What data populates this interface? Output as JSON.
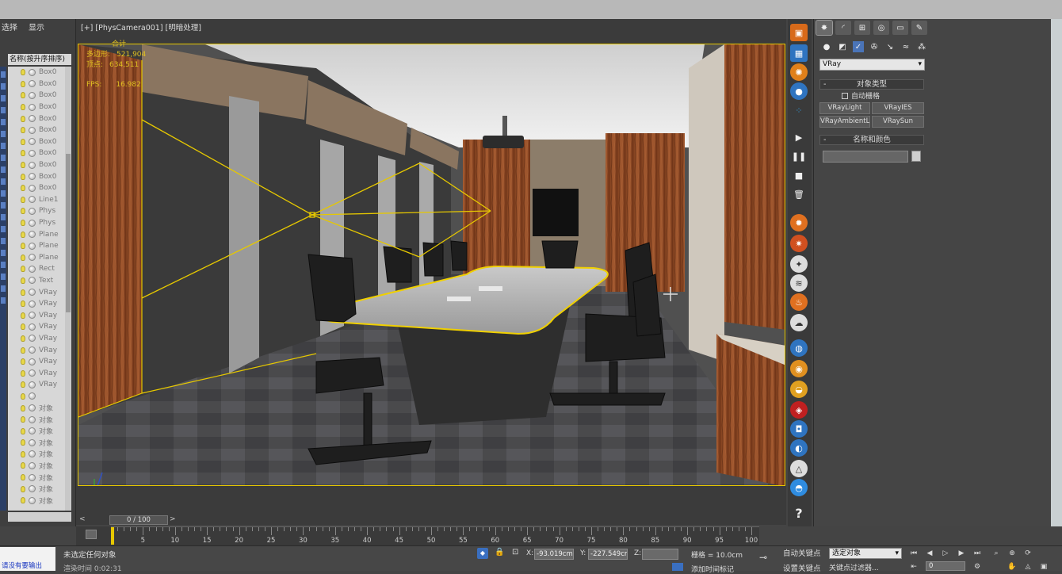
{
  "left_panel": {
    "menu": [
      "选择",
      "显示"
    ],
    "header": "名称(按升序排序)",
    "items": [
      {
        "label": "Box0",
        "icon": "lightbulb-icon"
      },
      {
        "label": "Box0",
        "icon": "lightbulb-icon"
      },
      {
        "label": "Box0",
        "icon": "lightbulb-icon"
      },
      {
        "label": "Box0",
        "icon": "lightbulb-icon"
      },
      {
        "label": "Box0",
        "icon": "lightbulb-icon"
      },
      {
        "label": "Box0",
        "icon": "lightbulb-icon"
      },
      {
        "label": "Box0",
        "icon": "lightbulb-icon"
      },
      {
        "label": "Box0",
        "icon": "lightbulb-icon"
      },
      {
        "label": "Box0",
        "icon": "lightbulb-icon"
      },
      {
        "label": "Box0",
        "icon": "lightbulb-icon"
      },
      {
        "label": "Box0",
        "icon": "lightbulb-icon"
      },
      {
        "label": "Line1",
        "icon": "lightbulb-icon"
      },
      {
        "label": "Phys",
        "icon": "camera-icon"
      },
      {
        "label": "Phys",
        "icon": "camera-icon"
      },
      {
        "label": "Plane",
        "icon": "lightbulb-icon"
      },
      {
        "label": "Plane",
        "icon": "lightbulb-icon"
      },
      {
        "label": "Plane",
        "icon": "lightbulb-icon"
      },
      {
        "label": "Rect",
        "icon": "lightbulb-icon"
      },
      {
        "label": "Text",
        "icon": "lightbulb-icon"
      },
      {
        "label": "VRay",
        "icon": "lightbulb-icon"
      },
      {
        "label": "VRay",
        "icon": "lightbulb-icon"
      },
      {
        "label": "VRay",
        "icon": "lightbulb-icon"
      },
      {
        "label": "VRay",
        "icon": "lightbulb-icon"
      },
      {
        "label": "VRay",
        "icon": "lightbulb-icon"
      },
      {
        "label": "VRay",
        "icon": "lightbulb-icon"
      },
      {
        "label": "VRay",
        "icon": "lightbulb-icon"
      },
      {
        "label": "VRay",
        "icon": "lightbulb-icon"
      },
      {
        "label": "VRay",
        "icon": "lightbulb-icon"
      },
      {
        "label": "",
        "icon": "lightbulb-icon"
      },
      {
        "label": "对象",
        "icon": "lightbulb-icon"
      },
      {
        "label": "对象",
        "icon": "lightbulb-icon"
      },
      {
        "label": "对象",
        "icon": "lightbulb-icon"
      },
      {
        "label": "对象",
        "icon": "lightbulb-icon"
      },
      {
        "label": "对象",
        "icon": "lightbulb-icon"
      },
      {
        "label": "对象",
        "icon": "lightbulb-icon"
      },
      {
        "label": "对象",
        "icon": "lightbulb-icon"
      },
      {
        "label": "对象",
        "icon": "lightbulb-icon"
      },
      {
        "label": "对象",
        "icon": "lightbulb-icon"
      }
    ]
  },
  "viewport": {
    "label": "[+] [PhysCamera001] [明暗处理]",
    "stats": {
      "title": "合计",
      "polys_label": "多边形:",
      "polys_value": "521,904",
      "verts_label": "顶点:",
      "verts_value": "634,511",
      "fps_label": "FPS:",
      "fps_value": "16.982"
    }
  },
  "command_panel": {
    "renderer_dropdown": "VRay",
    "object_type": {
      "title": "对象类型",
      "autogrid": "自动栅格",
      "buttons": [
        "VRayLight",
        "VRayIES",
        "VRayAmbientLight",
        "VRaySun"
      ]
    },
    "name_color": {
      "title": "名称和颜色"
    }
  },
  "timeline": {
    "frame": "0 / 100",
    "ticks": [
      5,
      10,
      15,
      20,
      25,
      30,
      35,
      40,
      45,
      50,
      55,
      60,
      65,
      70,
      75,
      80,
      85,
      90,
      95,
      100
    ]
  },
  "status": {
    "maxscript": "请没有要输出",
    "selection": "未选定任何对象",
    "render_time": "渲染时间  0:02:31",
    "x_label": "X:",
    "x_value": "-93.019cm",
    "y_label": "Y:",
    "y_value": "-227.549cm",
    "z_label": "Z:",
    "z_value": "",
    "grid": "栅格 = 10.0cm",
    "add_time_tag": "添加时间标记",
    "auto_key": "自动关键点",
    "set_key": "设置关键点",
    "selected_dropdown": "选定对象",
    "key_filters": "关键点过滤器...",
    "current_frame": "0"
  }
}
